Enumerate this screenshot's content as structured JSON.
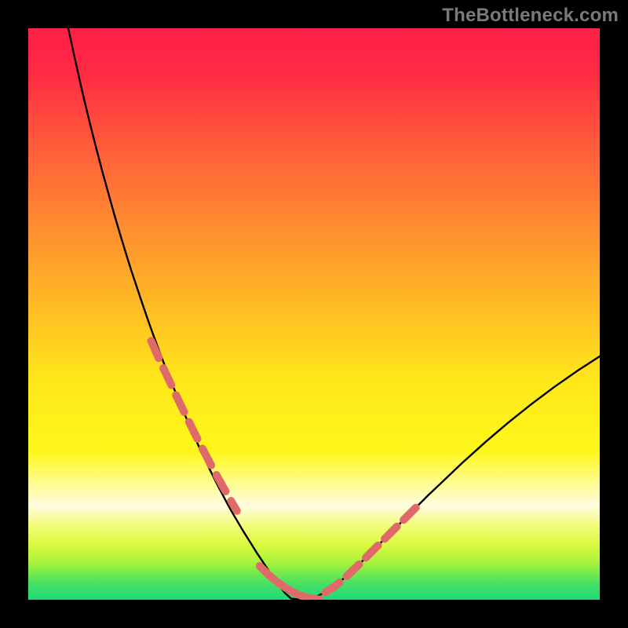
{
  "watermark": "TheBottleneck.com",
  "gradient": {
    "stops": [
      {
        "offset": 0.0,
        "color": "#ff1f47"
      },
      {
        "offset": 0.08,
        "color": "#ff2b44"
      },
      {
        "offset": 0.2,
        "color": "#ff5a3a"
      },
      {
        "offset": 0.35,
        "color": "#ff8e2f"
      },
      {
        "offset": 0.5,
        "color": "#ffc023"
      },
      {
        "offset": 0.62,
        "color": "#ffe81a"
      },
      {
        "offset": 0.74,
        "color": "#fdf71a"
      },
      {
        "offset": 0.8,
        "color": "#fffc9a"
      },
      {
        "offset": 0.835,
        "color": "#fffde0"
      },
      {
        "offset": 0.87,
        "color": "#f4fc7a"
      },
      {
        "offset": 0.905,
        "color": "#d7f93c"
      },
      {
        "offset": 0.935,
        "color": "#a8f23c"
      },
      {
        "offset": 0.955,
        "color": "#6fe94e"
      },
      {
        "offset": 0.975,
        "color": "#40df66"
      },
      {
        "offset": 1.0,
        "color": "#1fd97a"
      }
    ]
  },
  "chart_data": {
    "type": "line",
    "title": "",
    "xlabel": "",
    "ylabel": "",
    "xlim": [
      0,
      100
    ],
    "ylim": [
      0,
      100
    ],
    "series": [
      {
        "name": "curve",
        "color": "#000000",
        "stroke_width": 2.4,
        "x": [
          7,
          8,
          9,
          10,
          11,
          12,
          13,
          14,
          15,
          16,
          17,
          18,
          19,
          20,
          21,
          22,
          23,
          24,
          25,
          26,
          27,
          28,
          29,
          30,
          31,
          32,
          33,
          33.5,
          34,
          34.5,
          35,
          35.5,
          36,
          36.5,
          37,
          37.5,
          38,
          39,
          40,
          41,
          42,
          43,
          44,
          45,
          46,
          48,
          50,
          52,
          54,
          56,
          58,
          60,
          62,
          64,
          66,
          68,
          70,
          72,
          74,
          76,
          78,
          80,
          82,
          84,
          86,
          88,
          90,
          92,
          94,
          96,
          98,
          100
        ],
        "y": [
          100,
          95.4,
          90.9,
          86.6,
          82.5,
          78.6,
          74.8,
          71.2,
          67.6,
          64.2,
          60.9,
          57.7,
          54.7,
          51.7,
          48.8,
          46.0,
          43.3,
          40.7,
          38.2,
          35.7,
          33.3,
          31.0,
          28.7,
          26.5,
          24.4,
          22.3,
          20.3,
          19.35,
          18.4,
          17.45,
          16.5,
          15.6,
          14.75,
          13.9,
          13.05,
          12.2,
          11.4,
          9.8,
          8.2,
          6.7,
          5.2,
          3.7,
          2.3,
          1.1,
          0.2,
          0.0,
          0.4,
          1.3,
          2.7,
          4.4,
          6.3,
          8.3,
          10.3,
          12.3,
          14.3,
          16.3,
          18.3,
          20.2,
          22.1,
          24.0,
          25.8,
          27.6,
          29.3,
          31.0,
          32.6,
          34.2,
          35.7,
          37.2,
          38.6,
          40.0,
          41.3,
          42.6
        ]
      },
      {
        "name": "dash-overlay-left",
        "color": "#e06a6a",
        "stroke_width": 10,
        "dash": [
          24,
          14
        ],
        "x": [
          21.5,
          23,
          24.5,
          26,
          27.5,
          29,
          30.5,
          32,
          33.5,
          35,
          36.5
        ],
        "y": [
          45.3,
          41.9,
          38.7,
          35.5,
          32.4,
          29.35,
          26.4,
          23.55,
          20.8,
          18.15,
          15.55
        ]
      },
      {
        "name": "dash-overlay-right",
        "color": "#e06a6a",
        "stroke_width": 10,
        "dash": [
          22,
          12
        ],
        "x": [
          52,
          53.5,
          55,
          56.5,
          58,
          59.5,
          61,
          62.5,
          64,
          65.5,
          67,
          68.5
        ],
        "y": [
          1.3,
          2.25,
          3.45,
          4.85,
          6.3,
          7.8,
          9.3,
          10.8,
          12.3,
          13.8,
          15.3,
          16.8
        ]
      },
      {
        "name": "dash-overlay-bottom",
        "color": "#e06a6a",
        "stroke_width": 10,
        "dash": [
          26,
          6
        ],
        "x": [
          40.5,
          42,
          43.5,
          45,
          46.5,
          48,
          49.5,
          51
        ],
        "y": [
          5.9,
          4.4,
          3.15,
          2.1,
          1.25,
          0.6,
          0.2,
          0.05
        ]
      }
    ],
    "grid": false,
    "legend": false
  }
}
